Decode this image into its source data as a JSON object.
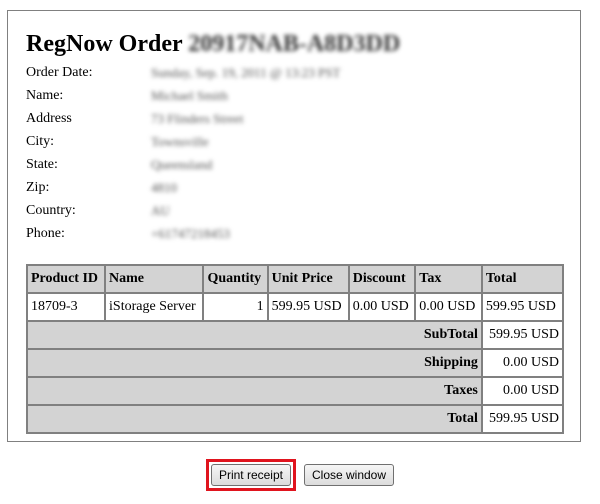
{
  "order": {
    "title_prefix": "RegNow Order",
    "order_id": "20917NAB-A8D3DD"
  },
  "details": [
    {
      "label": "Order Date:",
      "value": "Sunday, Sep. 19, 2011 @ 13:23 PST"
    },
    {
      "label": "Name:",
      "value": "Michael Smith"
    },
    {
      "label": "Address",
      "value": "73 Flinders Street"
    },
    {
      "label": "City:",
      "value": "Townsville"
    },
    {
      "label": "State:",
      "value": "Queensland"
    },
    {
      "label": "Zip:",
      "value": "4810"
    },
    {
      "label": "Country:",
      "value": "AU"
    },
    {
      "label": "Phone:",
      "value": "+61747218453"
    }
  ],
  "table": {
    "headers": [
      "Product ID",
      "Name",
      "Quantity",
      "Unit Price",
      "Discount",
      "Tax",
      "Total"
    ],
    "rows": [
      [
        "18709-3",
        "iStorage Server",
        "1",
        "599.95 USD",
        "0.00 USD",
        "0.00 USD",
        "599.95 USD"
      ]
    ],
    "summary": [
      {
        "label": "SubTotal",
        "value": "599.95 USD"
      },
      {
        "label": "Shipping",
        "value": "0.00 USD"
      },
      {
        "label": "Taxes",
        "value": "0.00 USD"
      },
      {
        "label": "Total",
        "value": "599.95 USD"
      }
    ]
  },
  "buttons": {
    "print_label": "Print receipt",
    "close_label": "Close window",
    "highlight_color": "#e0141e"
  }
}
